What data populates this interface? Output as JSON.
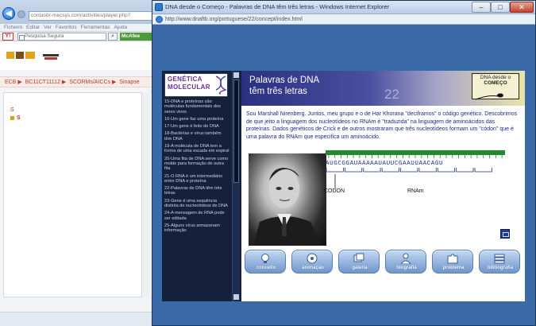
{
  "bg_browser": {
    "url": "contasbr-mecsys.com/activities/player.php?",
    "menu": [
      "Ficheiro",
      "Editar",
      "Ver",
      "Favoritos",
      "Ferramentas",
      "Ajuda"
    ],
    "search_placeholder": "Pesquisa Segura",
    "search_brand": "McAfee",
    "breadcrumb": [
      "ECB ▶",
      "BC11CT11112 ▶",
      "SCORMs/AICCs ▶",
      "Sinapse"
    ],
    "s_label": "S",
    "s_item": "S"
  },
  "popup": {
    "title": "DNA desde o Começo - Palavras de DNA têm três letras - Windows Internet Explorer",
    "url": "http://www.dnaftb.org/portuguese/22/concept/index.html",
    "min": "–",
    "max": "□",
    "close": "✕"
  },
  "app": {
    "logo_line1": "GENÉTICA",
    "logo_line2": "MOLECULAR",
    "sidebar_items": [
      "15-DNA e proteínas são moléculas fundamentais dos seres vivos",
      "16-Um gene faz uma proteína",
      "17-Um gene é feito de DNA",
      "18-Bactérias e vírus também têm DNA",
      "19-A molécula de DNA tem a forma de uma escada em espiral",
      "20-Uma fita de DNA serve como molde para formação de outra fita",
      "21-O RNA é um intermediário entre DNA e proteína",
      "22-Palavras de DNA têm três letras",
      "23-Gene é uma sequência distinta de nucleotídeos de DNA",
      "24-A mensagem de RNA pode ser editada",
      "25-Alguns vírus armazenam informação"
    ],
    "header_title_1": "Palavras de DNA",
    "header_title_2": "têm três letras",
    "header_number": "22",
    "badge_line1": "DNA desde o",
    "badge_line2": "COMEÇO",
    "body_text": "Sou Marshall Nirenberg. Juntos, meu grupo e o de Har Khorana \"deciframos\" o código genético. Descobrimos de que jeito a linguagem dos nucleotídeos no RNAm é \"traduzida\" na linguagem de aminoácidos das proteínas. Dados genéticos de Crick e de outros mostraram que três nucleotídeos formam um \"códon\" que é uma palavra do RNAm que especifica um aminoácido.",
    "sequence": "AUGCGGAUAAAAAUAUUCGAAUUAACAGU",
    "codon_label": "CODON",
    "rnam_label": "RNAm",
    "nav": [
      "conceito",
      "animação",
      "galeria",
      "biografia",
      "problema",
      "bibliografia"
    ]
  }
}
